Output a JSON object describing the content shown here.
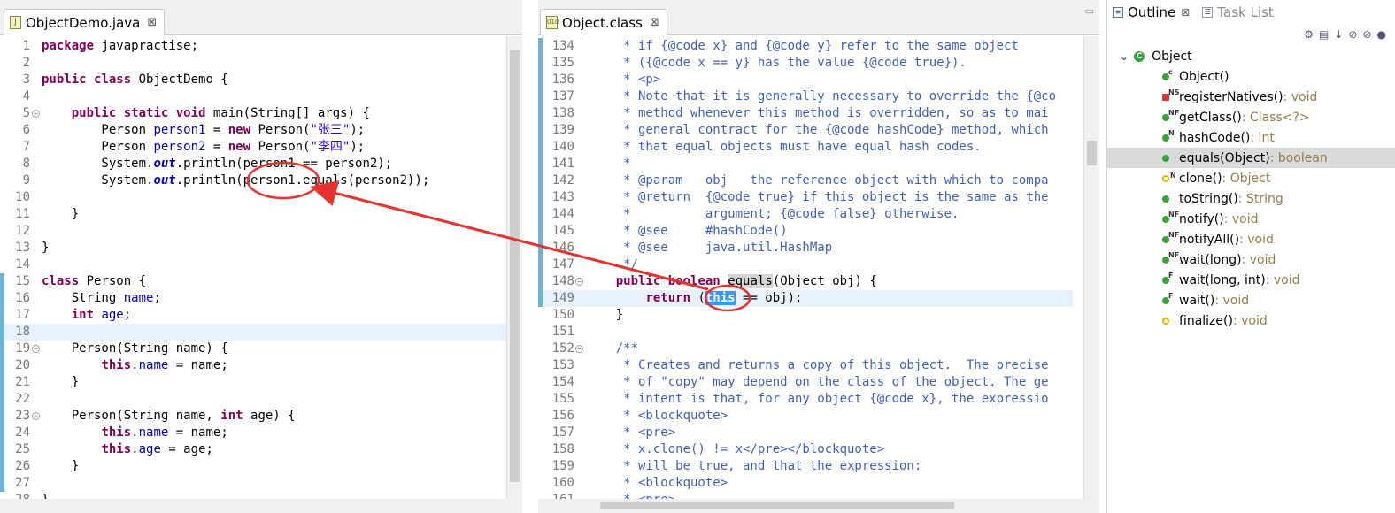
{
  "left_editor": {
    "tab": {
      "title": "ObjectDemo.java",
      "close": "⊠",
      "icon": "J"
    },
    "lines": [
      {
        "n": "1",
        "parts": [
          [
            "k",
            "package"
          ],
          [
            "t",
            " javapractise;"
          ]
        ]
      },
      {
        "n": "2",
        "parts": []
      },
      {
        "n": "3",
        "parts": [
          [
            "k",
            "public"
          ],
          [
            "t",
            " "
          ],
          [
            "k",
            "class"
          ],
          [
            "t",
            " ObjectDemo {"
          ]
        ]
      },
      {
        "n": "4",
        "parts": []
      },
      {
        "n": "5",
        "fold": true,
        "parts": [
          [
            "t",
            "    "
          ],
          [
            "k",
            "public"
          ],
          [
            "t",
            " "
          ],
          [
            "k",
            "static"
          ],
          [
            "t",
            " "
          ],
          [
            "k",
            "void"
          ],
          [
            "t",
            " main(String[] args) {"
          ]
        ]
      },
      {
        "n": "6",
        "parts": [
          [
            "t",
            "        Person "
          ],
          [
            "f",
            "person1"
          ],
          [
            "t",
            " = "
          ],
          [
            "k",
            "new"
          ],
          [
            "t",
            " Person("
          ],
          [
            "s",
            "\"张三\""
          ],
          [
            "t",
            ");"
          ]
        ]
      },
      {
        "n": "7",
        "parts": [
          [
            "t",
            "        Person "
          ],
          [
            "f",
            "person2"
          ],
          [
            "t",
            " = "
          ],
          [
            "k",
            "new"
          ],
          [
            "t",
            " Person("
          ],
          [
            "s",
            "\"李四\""
          ],
          [
            "t",
            ");"
          ]
        ]
      },
      {
        "n": "8",
        "parts": [
          [
            "t",
            "        System."
          ],
          [
            "fi",
            "out"
          ],
          [
            "t",
            ".println(person1 == person2);"
          ]
        ]
      },
      {
        "n": "9",
        "parts": [
          [
            "t",
            "        System."
          ],
          [
            "fi",
            "out"
          ],
          [
            "t",
            ".println(person1.equals(person2));"
          ]
        ]
      },
      {
        "n": "10",
        "parts": []
      },
      {
        "n": "11",
        "parts": [
          [
            "t",
            "    }"
          ]
        ]
      },
      {
        "n": "12",
        "parts": []
      },
      {
        "n": "13",
        "parts": [
          [
            "t",
            "}"
          ]
        ]
      },
      {
        "n": "14",
        "parts": []
      },
      {
        "n": "15",
        "ruler": true,
        "parts": [
          [
            "k",
            "class"
          ],
          [
            "t",
            " Person {"
          ]
        ]
      },
      {
        "n": "16",
        "ruler": true,
        "parts": [
          [
            "t",
            "    String "
          ],
          [
            "f",
            "name"
          ],
          [
            "t",
            ";"
          ]
        ]
      },
      {
        "n": "17",
        "ruler": true,
        "parts": [
          [
            "t",
            "    "
          ],
          [
            "k",
            "int"
          ],
          [
            "t",
            " "
          ],
          [
            "f",
            "age"
          ],
          [
            "t",
            ";"
          ]
        ]
      },
      {
        "n": "18",
        "ruler": true,
        "cur": true,
        "parts": []
      },
      {
        "n": "19",
        "ruler": true,
        "fold": true,
        "parts": [
          [
            "t",
            "    Person(String name) {"
          ]
        ]
      },
      {
        "n": "20",
        "ruler": true,
        "parts": [
          [
            "t",
            "        "
          ],
          [
            "k",
            "this"
          ],
          [
            "t",
            "."
          ],
          [
            "f",
            "name"
          ],
          [
            "t",
            " = name;"
          ]
        ]
      },
      {
        "n": "21",
        "ruler": true,
        "parts": [
          [
            "t",
            "    }"
          ]
        ]
      },
      {
        "n": "22",
        "ruler": true,
        "parts": []
      },
      {
        "n": "23",
        "ruler": true,
        "fold": true,
        "parts": [
          [
            "t",
            "    Person(String name, "
          ],
          [
            "k",
            "int"
          ],
          [
            "t",
            " age) {"
          ]
        ]
      },
      {
        "n": "24",
        "ruler": true,
        "parts": [
          [
            "t",
            "        "
          ],
          [
            "k",
            "this"
          ],
          [
            "t",
            "."
          ],
          [
            "f",
            "name"
          ],
          [
            "t",
            " = name;"
          ]
        ]
      },
      {
        "n": "25",
        "ruler": true,
        "parts": [
          [
            "t",
            "        "
          ],
          [
            "k",
            "this"
          ],
          [
            "t",
            "."
          ],
          [
            "f",
            "age"
          ],
          [
            "t",
            " = age;"
          ]
        ]
      },
      {
        "n": "26",
        "ruler": true,
        "parts": [
          [
            "t",
            "    }"
          ]
        ]
      },
      {
        "n": "27",
        "ruler": true,
        "parts": []
      },
      {
        "n": "28",
        "parts": [
          [
            "t",
            "}"
          ]
        ]
      }
    ]
  },
  "mid_editor": {
    "tab": {
      "title": "Object.class",
      "close": "⊠",
      "icon": "010"
    },
    "lines": [
      {
        "n": "134",
        "ruler": true,
        "parts": [
          [
            "c",
            "     * if {@code x} and {@code y} refer to the same object"
          ]
        ]
      },
      {
        "n": "135",
        "ruler": true,
        "parts": [
          [
            "c",
            "     * ({@code x == y} has the value {@code true})."
          ]
        ]
      },
      {
        "n": "136",
        "ruler": true,
        "parts": [
          [
            "c",
            "     * <p>"
          ]
        ]
      },
      {
        "n": "137",
        "ruler": true,
        "parts": [
          [
            "c",
            "     * Note that it is generally necessary to override the {@co"
          ]
        ]
      },
      {
        "n": "138",
        "ruler": true,
        "parts": [
          [
            "c",
            "     * method whenever this method is overridden, so as to mai"
          ]
        ]
      },
      {
        "n": "139",
        "ruler": true,
        "parts": [
          [
            "c",
            "     * general contract for the {@code hashCode} method, which"
          ]
        ]
      },
      {
        "n": "140",
        "ruler": true,
        "parts": [
          [
            "c",
            "     * that equal objects must have equal hash codes."
          ]
        ]
      },
      {
        "n": "141",
        "ruler": true,
        "parts": [
          [
            "c",
            "     *"
          ]
        ]
      },
      {
        "n": "142",
        "ruler": true,
        "parts": [
          [
            "c",
            "     * @param   obj   the reference object with which to compa"
          ]
        ]
      },
      {
        "n": "143",
        "ruler": true,
        "parts": [
          [
            "c",
            "     * @return  {@code true} if this object is the same as the"
          ]
        ]
      },
      {
        "n": "144",
        "ruler": true,
        "parts": [
          [
            "c",
            "     *          argument; {@code false} otherwise."
          ]
        ]
      },
      {
        "n": "145",
        "ruler": true,
        "parts": [
          [
            "c",
            "     * @see     #hashCode()"
          ]
        ]
      },
      {
        "n": "146",
        "ruler": true,
        "parts": [
          [
            "c",
            "     * @see     java.util.HashMap"
          ]
        ]
      },
      {
        "n": "147",
        "ruler": true,
        "parts": [
          [
            "c",
            "     */"
          ]
        ]
      },
      {
        "n": "148",
        "ruler": true,
        "fold": true,
        "parts": [
          [
            "t",
            "    "
          ],
          [
            "k",
            "public"
          ],
          [
            "t",
            " "
          ],
          [
            "k",
            "boolean"
          ],
          [
            "t",
            " "
          ],
          [
            "hl",
            "equals"
          ],
          [
            "t",
            "(Object obj) {"
          ]
        ]
      },
      {
        "n": "149",
        "ruler": true,
        "cur": true,
        "parts": [
          [
            "t",
            "        "
          ],
          [
            "k",
            "return"
          ],
          [
            "t",
            " ("
          ],
          [
            "sel",
            "this"
          ],
          [
            "t",
            " == obj);"
          ]
        ]
      },
      {
        "n": "150",
        "parts": [
          [
            "t",
            "    }"
          ]
        ]
      },
      {
        "n": "151",
        "parts": []
      },
      {
        "n": "152",
        "fold": true,
        "parts": [
          [
            "c",
            "    /**"
          ]
        ]
      },
      {
        "n": "153",
        "parts": [
          [
            "c",
            "     * Creates and returns a copy of this object.  The precise"
          ]
        ]
      },
      {
        "n": "154",
        "parts": [
          [
            "c",
            "     * of \"copy\" may depend on the class of the object. The ge"
          ]
        ]
      },
      {
        "n": "155",
        "parts": [
          [
            "c",
            "     * intent is that, for any object {@code x}, the expressio"
          ]
        ]
      },
      {
        "n": "156",
        "parts": [
          [
            "c",
            "     * <blockquote>"
          ]
        ]
      },
      {
        "n": "157",
        "parts": [
          [
            "c",
            "     * <pre>"
          ]
        ]
      },
      {
        "n": "158",
        "parts": [
          [
            "c",
            "     * x.clone() != x</pre></blockquote>"
          ]
        ]
      },
      {
        "n": "159",
        "parts": [
          [
            "c",
            "     * will be true, and that the expression:"
          ]
        ]
      },
      {
        "n": "160",
        "parts": [
          [
            "c",
            "     * <blockquote>"
          ]
        ]
      },
      {
        "n": "161",
        "parts": [
          [
            "c",
            "     * <pre>"
          ]
        ]
      }
    ]
  },
  "outline": {
    "tabs": [
      {
        "title": "Outline",
        "close": "⊠",
        "active": true
      },
      {
        "title": "Task List",
        "active": false
      }
    ],
    "root": {
      "name": "Object",
      "expander": "⌄"
    },
    "items": [
      {
        "name": "Object()",
        "type": "",
        "dot": "#3aa23a",
        "sup": "c"
      },
      {
        "name": "registerNatives()",
        "type": " : void",
        "dot": "#d03a3a",
        "sup": "NS",
        "square": true
      },
      {
        "name": "getClass()",
        "type": " : Class<?>",
        "dot": "#3aa23a",
        "sup": "NF"
      },
      {
        "name": "hashCode()",
        "type": " : int",
        "dot": "#3aa23a",
        "sup": "N"
      },
      {
        "name": "equals(Object)",
        "type": " : boolean",
        "dot": "#3aa23a",
        "sup": "",
        "selected": true
      },
      {
        "name": "clone()",
        "type": " : Object",
        "dot": "#e8b400",
        "sup": "N",
        "hollow": true
      },
      {
        "name": "toString()",
        "type": " : String",
        "dot": "#3aa23a",
        "sup": ""
      },
      {
        "name": "notify()",
        "type": " : void",
        "dot": "#3aa23a",
        "sup": "NF"
      },
      {
        "name": "notifyAll()",
        "type": " : void",
        "dot": "#3aa23a",
        "sup": "NF"
      },
      {
        "name": "wait(long)",
        "type": " : void",
        "dot": "#3aa23a",
        "sup": "NF"
      },
      {
        "name": "wait(long, int)",
        "type": " : void",
        "dot": "#3aa23a",
        "sup": "F"
      },
      {
        "name": "wait()",
        "type": " : void",
        "dot": "#3aa23a",
        "sup": "F"
      },
      {
        "name": "finalize()",
        "type": " : void",
        "dot": "#e8b400",
        "sup": "",
        "hollow": true
      }
    ]
  }
}
